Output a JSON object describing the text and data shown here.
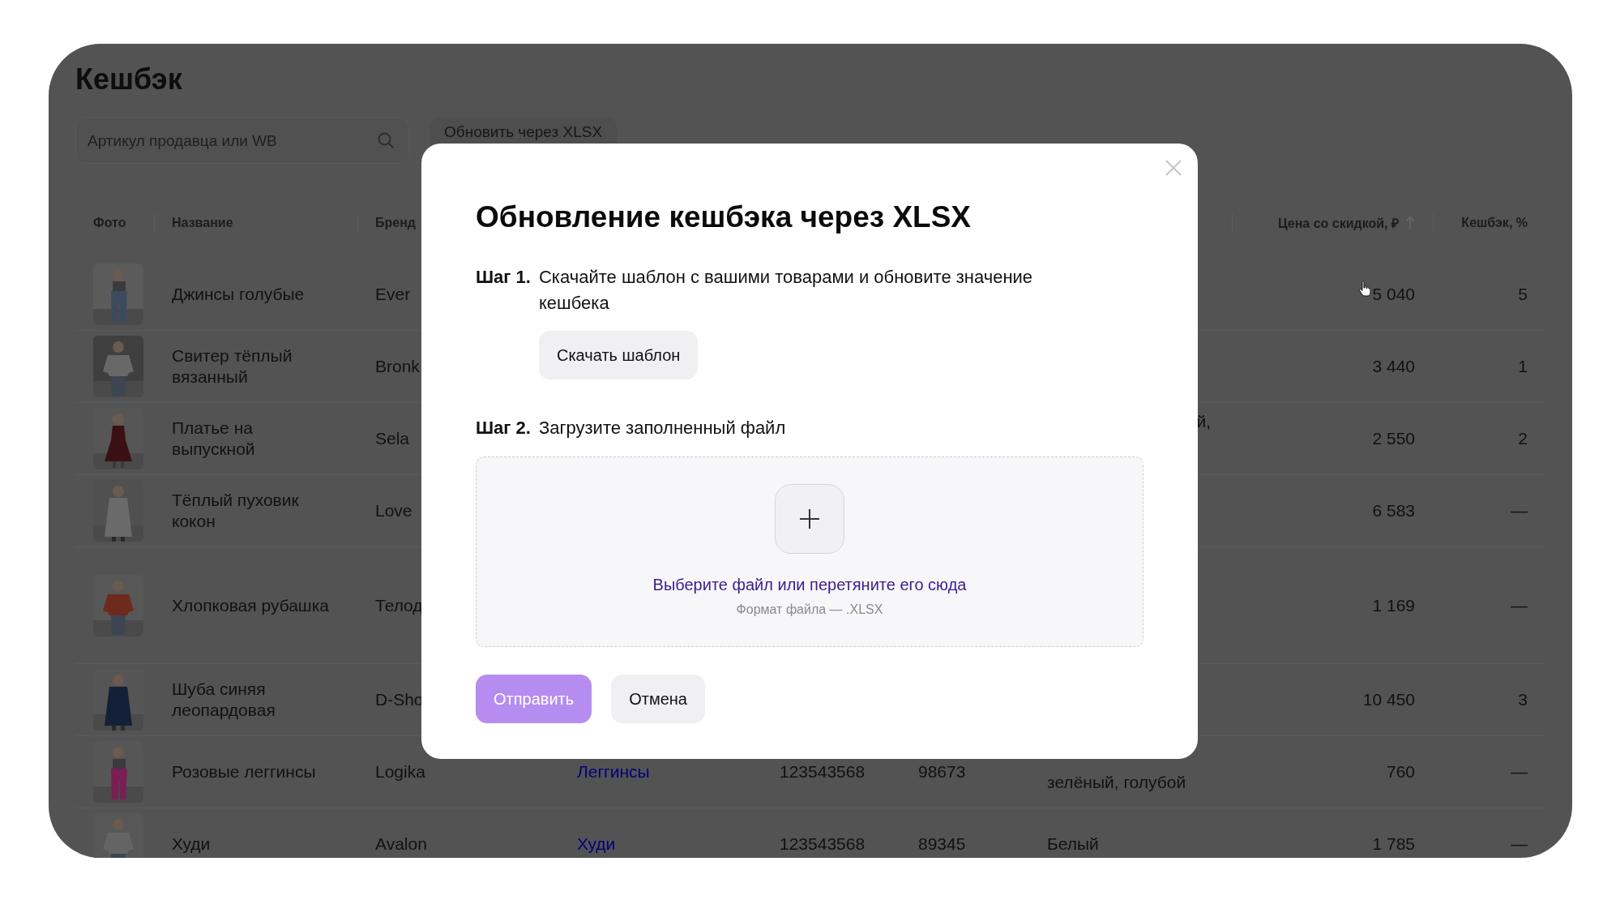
{
  "page": {
    "title": "Кешбэк"
  },
  "search": {
    "placeholder": "Артикул продавца или WB"
  },
  "toolbar_button": "Обновить через XLSX",
  "table": {
    "columns": [
      {
        "label": "Фото"
      },
      {
        "label": "Название"
      },
      {
        "label": "Бренд"
      },
      {
        "label": "Цена со скидкой, ₽",
        "sorted": true
      },
      {
        "label": "Кешбэк, %"
      }
    ],
    "rows": [
      {
        "name": "Джинсы голубые",
        "brand": "Ever",
        "price": "5 040",
        "cashback": "5"
      },
      {
        "name": "Свитер тёплый вязанный",
        "brand": "Bronk",
        "price": "3 440",
        "cashback": "1"
      },
      {
        "name": "Платье на выпускной",
        "brand": "Sela",
        "column_7": "й,",
        "price": "2 550",
        "cashback": "2"
      },
      {
        "name": "Тёплый пуховик кокон",
        "brand": "Love",
        "price": "6 583",
        "cashback": "—"
      },
      {
        "name": "Хлопковая рубашка",
        "brand": "Телод",
        "price": "1 169",
        "cashback": "—"
      },
      {
        "name": "Шуба синяя леопардовая",
        "brand": "D-Sho",
        "price": "10 450",
        "cashback": "3"
      },
      {
        "name": "Розовые леггинсы",
        "brand": "Logika",
        "column_4": "Леггинсы",
        "column_5": "123543568",
        "column_6": "98673",
        "column_7": "зелёный, голубой",
        "price": "760",
        "cashback": "—"
      },
      {
        "name": "Худи",
        "brand": "Avalon",
        "column_4": "Худи",
        "column_5": "123543568",
        "column_6": "89345",
        "column_7": "Белый",
        "price": "1 785",
        "cashback": "—"
      }
    ]
  },
  "dialog": {
    "title": "Обновление кешбэка через XLSX",
    "steps": [
      {
        "number": "Шаг 1.",
        "text": "Скачайте шаблон с вашими товарами и обновите значение кешбека",
        "button": "Скачать шаблон"
      },
      {
        "number": "Шаг 2.",
        "text": "Загрузите заполненный файл"
      }
    ],
    "upload": {
      "link": "Выберите файл или перетяните его сюда",
      "hint": "Формат файла — .XLSX"
    },
    "buttons": [
      {
        "label": "Отправить",
        "kind": "primary",
        "disabled": true
      },
      {
        "label": "Отмена",
        "kind": "secondary"
      }
    ]
  }
}
